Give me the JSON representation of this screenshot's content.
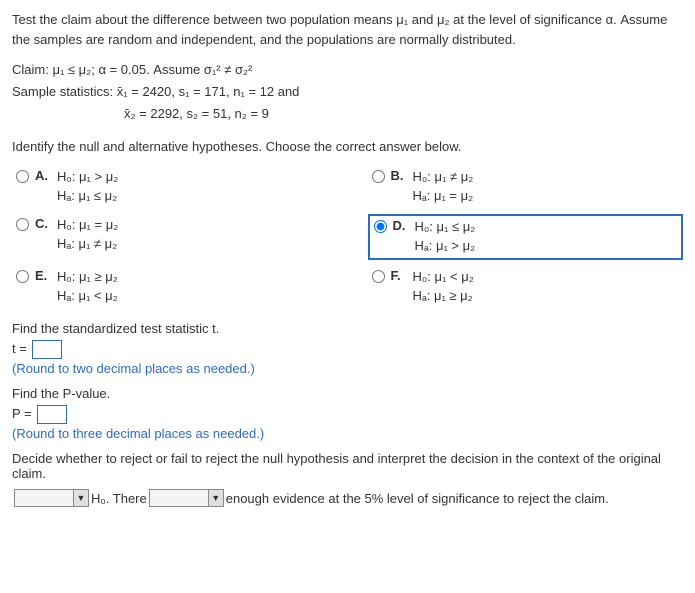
{
  "intro": "Test the claim about the difference between two population means μ₁ and μ₂ at the level of significance α. Assume the samples are random and independent, and the populations are normally distributed.",
  "claim_line": "Claim: μ₁ ≤ μ₂; α = 0.05. Assume σ₁² ≠ σ₂²",
  "stats1": "Sample statistics:  x̄₁ = 2420, s₁ = 171, n₁ = 12 and",
  "stats2": "x̄₂ = 2292, s₂ = 51, n₂ = 9",
  "q_hyp": "Identify the null and alternative hypotheses. Choose the correct answer below.",
  "choices": {
    "A": {
      "h0": "H₀: μ₁ > μ₂",
      "ha": "Hₐ: μ₁ ≤ μ₂"
    },
    "B": {
      "h0": "H₀: μ₁ ≠ μ₂",
      "ha": "Hₐ: μ₁ = μ₂"
    },
    "C": {
      "h0": "H₀: μ₁ = μ₂",
      "ha": "Hₐ: μ₁ ≠ μ₂"
    },
    "D": {
      "h0": "H₀: μ₁ ≤ μ₂",
      "ha": "Hₐ: μ₁ > μ₂"
    },
    "E": {
      "h0": "H₀: μ₁ ≥ μ₂",
      "ha": "Hₐ: μ₁ < μ₂"
    },
    "F": {
      "h0": "H₀: μ₁ < μ₂",
      "ha": "Hₐ: μ₁ ≥ μ₂"
    }
  },
  "selected": "D",
  "find_t": "Find the standardized test statistic t.",
  "t_prefix": "t = ",
  "hint_t": "(Round to two decimal places as needed.)",
  "find_p": "Find the P-value.",
  "p_prefix": "P = ",
  "hint_p": "(Round to three decimal places as needed.)",
  "decide": "Decide whether to reject or fail to reject the null hypothesis and interpret the decision in the context of the original claim.",
  "final_mid1": " H₀. There ",
  "final_mid2": " enough evidence at the 5% level of significance to reject the claim.",
  "letters": {
    "A": "A.",
    "B": "B.",
    "C": "C.",
    "D": "D.",
    "E": "E.",
    "F": "F."
  }
}
